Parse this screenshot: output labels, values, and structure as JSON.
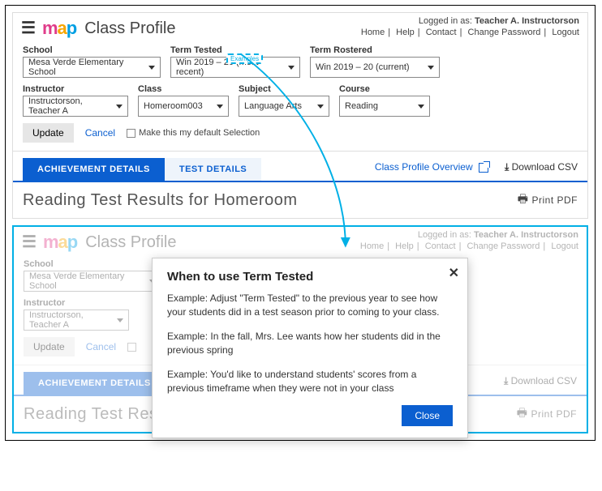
{
  "header": {
    "pageTitle": "Class Profile",
    "loggedInPrefix": "Logged in as:",
    "userName": "Teacher A. Instructorson",
    "links": {
      "home": "Home",
      "help": "Help",
      "contact": "Contact",
      "changePassword": "Change Password",
      "logout": "Logout"
    }
  },
  "filters": {
    "school": {
      "label": "School",
      "value": "Mesa Verde Elementary School"
    },
    "termTested": {
      "label": "Term Tested",
      "value": "Win 2019 – 20 (most recent)"
    },
    "termRostered": {
      "label": "Term Rostered",
      "value": "Win 2019 – 20 (current)"
    },
    "instructor": {
      "label": "Instructor",
      "value": "Instructorson, Teacher A"
    },
    "class": {
      "label": "Class",
      "value": "Homeroom003"
    },
    "subject": {
      "label": "Subject",
      "value": "Language Arts"
    },
    "course": {
      "label": "Course",
      "value": "Reading"
    }
  },
  "actions": {
    "update": "Update",
    "cancel": "Cancel",
    "defaultSelection": "Make this my default Selection"
  },
  "tabs": {
    "achievement": "ACHIEVEMENT DETAILS",
    "testDetails": "TEST DETAILS",
    "overviewLink": "Class Profile Overview",
    "downloadCsv": "Download CSV"
  },
  "results": {
    "title": "Reading Test Results for Homeroom",
    "printPdf": "Print PDF"
  },
  "exampleBadge": "Examples",
  "modal": {
    "title": "When to use Term Tested",
    "p1": "Example: Adjust \"Term Tested\" to the previous year to see how your students did in a test season prior to coming to your class.",
    "p2": "Example: In the fall, Mrs. Lee wants how her students did in the previous spring",
    "p3": "Example: You'd like to understand students' scores from a previous timeframe when they were not in your class",
    "close": "Close"
  }
}
